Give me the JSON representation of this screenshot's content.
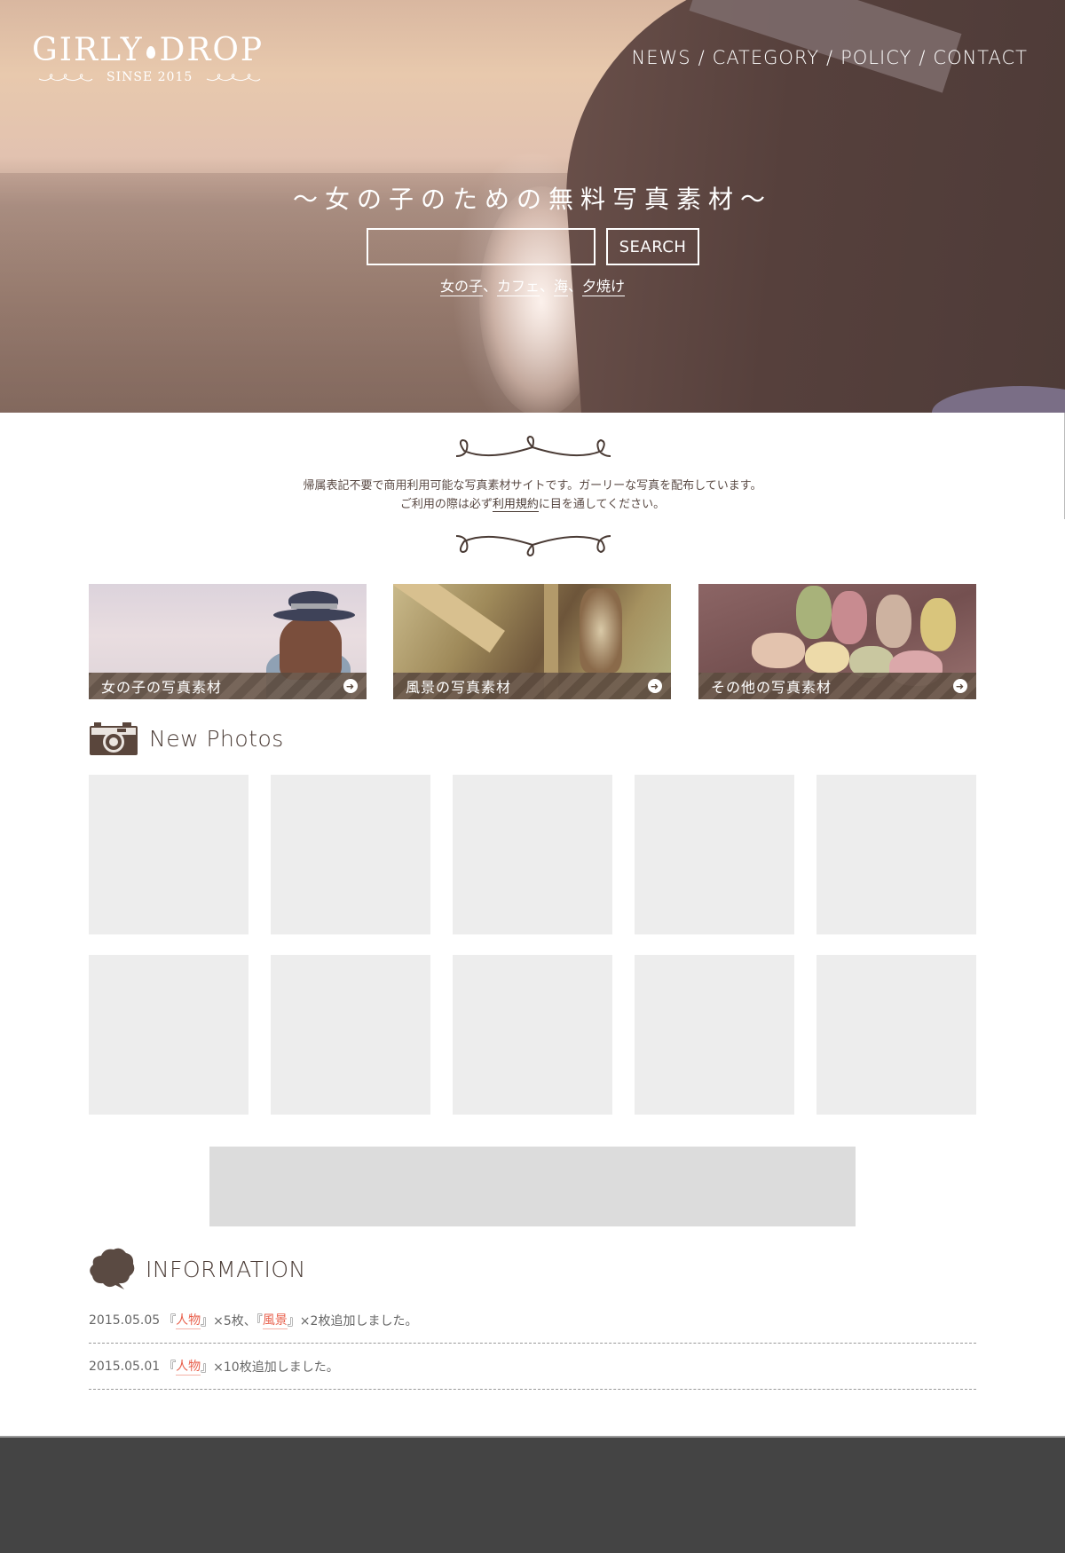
{
  "header": {
    "logo": {
      "name_left": "GIRLY",
      "name_right": "DROP",
      "since": "SINSE 2015",
      "drop_icon": "water-drop-icon"
    },
    "nav": [
      {
        "label": "NEWS"
      },
      {
        "label": "CATEGORY"
      },
      {
        "label": "POLICY"
      },
      {
        "label": "CONTACT"
      }
    ],
    "nav_separator": "/"
  },
  "hero": {
    "tagline": "〜女の子のための無料写真素材〜",
    "search": {
      "value": "",
      "placeholder": "",
      "button_label": "SEARCH"
    },
    "tags": [
      "女の子",
      "カフェ",
      "海",
      "夕焼け"
    ],
    "tag_separator": "、"
  },
  "intro": {
    "line1": "帰属表記不要で商用利用可能な写真素材サイトです。ガーリーな写真を配布しています。",
    "line2_before": "ご利用の際は必ず",
    "line2_link": "利用規約",
    "line2_after": "に目を通してください。"
  },
  "categories": [
    {
      "label": "女の子の写真素材",
      "icon": "arrow-right-circle-icon"
    },
    {
      "label": "風景の写真素材",
      "icon": "arrow-right-circle-icon"
    },
    {
      "label": "その他の写真素材",
      "icon": "arrow-right-circle-icon"
    }
  ],
  "new_photos": {
    "title": "New Photos",
    "icon": "camera-icon",
    "tile_count": 10
  },
  "information": {
    "title": "INFORMATION",
    "icon": "speech-cloud-icon",
    "items": [
      {
        "date": "2015.05.05",
        "parts": [
          {
            "t": "『"
          },
          {
            "t": "人物",
            "link": true
          },
          {
            "t": "』×5枚、『"
          },
          {
            "t": "風景",
            "link": true
          },
          {
            "t": "』×2枚追加しました。"
          }
        ]
      },
      {
        "date": "2015.05.01",
        "parts": [
          {
            "t": "『"
          },
          {
            "t": "人物",
            "link": true
          },
          {
            "t": "』×10枚追加しました。"
          }
        ]
      }
    ]
  },
  "colors": {
    "text_brown": "#4a3b35",
    "accent_coral": "#e8604c",
    "placeholder_gray": "#ededed",
    "ad_gray": "#dcdcdc",
    "footer_gray": "#444444"
  }
}
